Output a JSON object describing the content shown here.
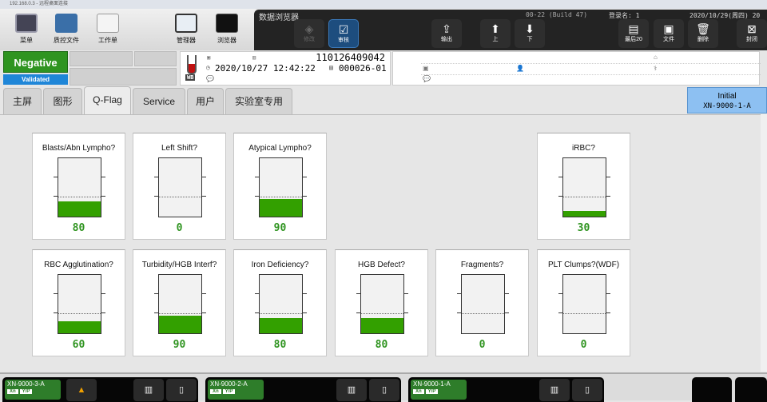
{
  "window": {
    "title": "192.168.0.3 - 远程桌面连接"
  },
  "toolbar": {
    "items": [
      {
        "label": "菜单",
        "icon": "menu-icon"
      },
      {
        "label": "质控文件",
        "icon": "qc-file-icon"
      },
      {
        "label": "工作单",
        "icon": "worksheet-icon"
      },
      {
        "label": "管理器",
        "icon": "manager-icon"
      },
      {
        "label": "浏览器",
        "icon": "browser-icon"
      }
    ]
  },
  "browser": {
    "title": "数据浏览器",
    "build": "00-22 (Build 47)",
    "login": "登录名: 1",
    "date": "2020/10/29(周四) 20",
    "buttons": [
      {
        "label": "修改",
        "icon": "edit-icon"
      },
      {
        "label": "审核",
        "icon": "check-icon"
      },
      {
        "label": "输出",
        "icon": "export-icon"
      },
      {
        "label": "上",
        "icon": "arrow-up-icon"
      },
      {
        "label": "下",
        "icon": "arrow-down-icon"
      },
      {
        "label": "最后20",
        "icon": "last20-icon"
      },
      {
        "label": "文件",
        "icon": "file-icon"
      },
      {
        "label": "删除",
        "icon": "trash-icon"
      },
      {
        "label": "封闭",
        "icon": "close-icon"
      }
    ]
  },
  "status": {
    "result": "Negative",
    "validation": "Validated",
    "result_color": "#2f9420",
    "validation_color": "#1f86d8"
  },
  "sample": {
    "tube": "WB",
    "sample_no": "110126409042",
    "datetime": "2020/10/27 12:42:22",
    "rack": "000026-01"
  },
  "tabs": [
    {
      "label": "主屏"
    },
    {
      "label": "图形"
    },
    {
      "label": "Q-Flag"
    },
    {
      "label": "Service"
    },
    {
      "label": "用户"
    },
    {
      "label": "实验室专用"
    }
  ],
  "active_tab": "Q-Flag",
  "initial": {
    "label": "Initial",
    "analyzer": "XN-9000-1-A"
  },
  "qflags": [
    {
      "label": "Blasts/Abn Lympho?",
      "value": 80
    },
    {
      "label": "Left Shift?",
      "value": 0
    },
    {
      "label": "Atypical Lympho?",
      "value": 90
    },
    {
      "label": "iRBC?",
      "value": 30
    },
    {
      "label": "RBC Agglutination?",
      "value": 60
    },
    {
      "label": "Turbidity/HGB Interf?",
      "value": 90
    },
    {
      "label": "Iron Deficiency?",
      "value": 80
    },
    {
      "label": "HGB Defect?",
      "value": 80
    },
    {
      "label": "Fragments?",
      "value": 0
    },
    {
      "label": "PLT Clumps?(WDF)",
      "value": 0
    }
  ],
  "qflag_scale": {
    "max": 300,
    "threshold": 100,
    "fill_color": "#33a000"
  },
  "analyzers": [
    {
      "name": "XN-9000-3-A",
      "warning": true
    },
    {
      "name": "XN-9000-2-A",
      "warning": false
    },
    {
      "name": "XN-9000-1-A",
      "warning": false
    }
  ],
  "analyzer_modes": [
    "Xn",
    "Y/P"
  ]
}
